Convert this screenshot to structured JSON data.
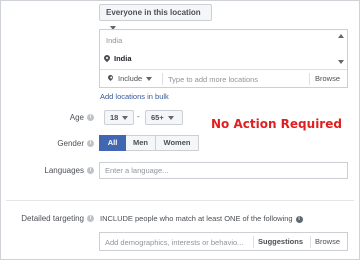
{
  "location": {
    "dropdown_label": "Everyone in this location",
    "country_header": "India",
    "selected_item": "India",
    "include_label": "Include",
    "input_placeholder": "Type to add more locations",
    "browse_label": "Browse",
    "bulk_link": "Add locations in bulk"
  },
  "age": {
    "label": "Age",
    "min": "18",
    "separator": "-",
    "max": "65+"
  },
  "annotation": {
    "text": "No Action Required",
    "color": "#e02020"
  },
  "gender": {
    "label": "Gender",
    "options": [
      "All",
      "Men",
      "Women"
    ],
    "selected": "All"
  },
  "languages": {
    "label": "Languages",
    "placeholder": "Enter a language..."
  },
  "detailed_targeting": {
    "label": "Detailed targeting",
    "include_text": "INCLUDE people who match at least ONE of the following",
    "input_placeholder": "Add demographics, interests or behavio...",
    "suggestions_label": "Suggestions",
    "browse_label": "Browse"
  },
  "colors": {
    "accent": "#4267b2",
    "link": "#365899"
  }
}
